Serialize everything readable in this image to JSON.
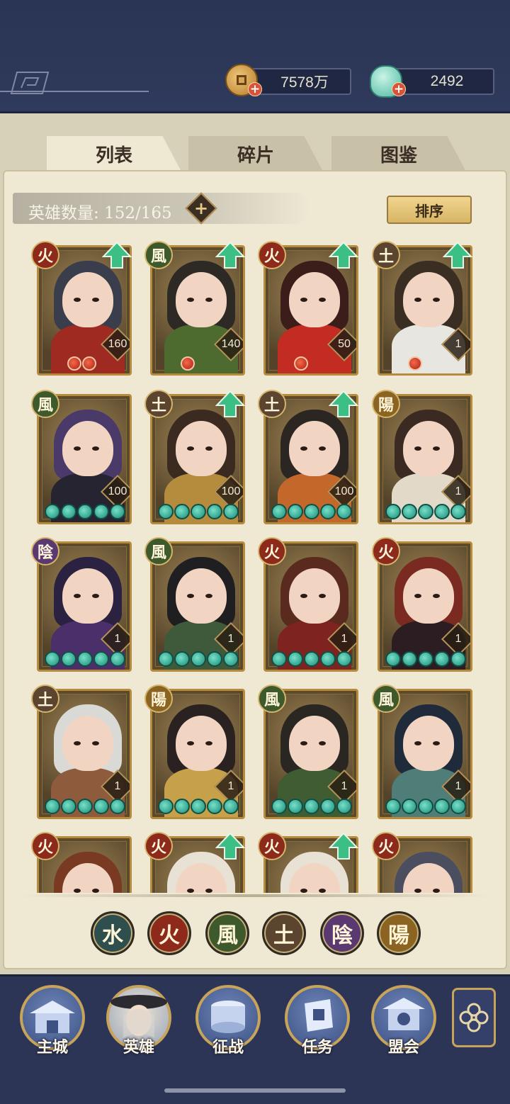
{
  "currency": {
    "coins": "7578万",
    "gems": "2492",
    "plus": "+"
  },
  "tabs": [
    "列表",
    "碎片",
    "图鉴"
  ],
  "hero_count": {
    "label": "英雄数量: 152/165",
    "plus": "+"
  },
  "sort_label": "排序",
  "heroes": [
    {
      "element": "火",
      "level": "160",
      "upgrade": true,
      "stars": 0,
      "badges": 2,
      "hair": "#3a3d4b",
      "outfit": "#9f2a22"
    },
    {
      "element": "風",
      "level": "140",
      "upgrade": true,
      "stars": 0,
      "badges": 1,
      "hair": "#2d2a25",
      "outfit": "#4d6b2f"
    },
    {
      "element": "火",
      "level": "50",
      "upgrade": true,
      "stars": 0,
      "badges": 1,
      "hair": "#3b1e1a",
      "outfit": "#c22c22"
    },
    {
      "element": "土",
      "level": "1",
      "upgrade": true,
      "stars": 0,
      "badges": 1,
      "hair": "#3a2e22",
      "outfit": "#e8e6e0"
    },
    {
      "element": "風",
      "level": "100",
      "upgrade": false,
      "stars": 5,
      "badges": 0,
      "hair": "#4a3a6a",
      "outfit": "#262430"
    },
    {
      "element": "土",
      "level": "100",
      "upgrade": true,
      "stars": 5,
      "badges": 0,
      "hair": "#3a2a20",
      "outfit": "#b58b3e"
    },
    {
      "element": "土",
      "level": "100",
      "upgrade": true,
      "stars": 5,
      "badges": 0,
      "hair": "#2c2622",
      "outfit": "#c4672a"
    },
    {
      "element": "陽",
      "level": "1",
      "upgrade": false,
      "stars": 5,
      "badges": 0,
      "hair": "#3a2a22",
      "outfit": "#e2d9c8"
    },
    {
      "element": "陰",
      "level": "1",
      "upgrade": false,
      "stars": 5,
      "badges": 0,
      "hair": "#2a2240",
      "outfit": "#4b2f6a"
    },
    {
      "element": "風",
      "level": "1",
      "upgrade": false,
      "stars": 5,
      "badges": 0,
      "hair": "#1f1f22",
      "outfit": "#3f5a3a"
    },
    {
      "element": "火",
      "level": "1",
      "upgrade": false,
      "stars": 5,
      "badges": 0,
      "hair": "#5a2a1e",
      "outfit": "#7e2320"
    },
    {
      "element": "火",
      "level": "1",
      "upgrade": false,
      "stars": 5,
      "badges": 0,
      "hair": "#7a2a20",
      "outfit": "#2b1d22"
    },
    {
      "element": "土",
      "level": "1",
      "upgrade": false,
      "stars": 5,
      "badges": 0,
      "hair": "#d9d9d6",
      "outfit": "#8e5b3d"
    },
    {
      "element": "陽",
      "level": "1",
      "upgrade": false,
      "stars": 5,
      "badges": 0,
      "hair": "#2a2220",
      "outfit": "#c7a14a"
    },
    {
      "element": "風",
      "level": "1",
      "upgrade": false,
      "stars": 5,
      "badges": 0,
      "hair": "#2a2622",
      "outfit": "#3f5c32"
    },
    {
      "element": "風",
      "level": "1",
      "upgrade": false,
      "stars": 5,
      "badges": 0,
      "hair": "#1f2a3a",
      "outfit": "#4f7d78"
    },
    {
      "element": "火",
      "level": "",
      "upgrade": false,
      "stars": 0,
      "badges": 0,
      "hair": "#7a3a22",
      "outfit": "#6a3522"
    },
    {
      "element": "火",
      "level": "",
      "upgrade": true,
      "stars": 0,
      "badges": 0,
      "hair": "#e8e2d4",
      "outfit": "#8c2a20"
    },
    {
      "element": "火",
      "level": "",
      "upgrade": true,
      "stars": 0,
      "badges": 0,
      "hair": "#e8e2d4",
      "outfit": "#8c2a20"
    },
    {
      "element": "火",
      "level": "",
      "upgrade": false,
      "stars": 0,
      "badges": 0,
      "hair": "#4a4e5e",
      "outfit": "#3a3d4b"
    }
  ],
  "filters": [
    {
      "label": "水",
      "class": "el-water"
    },
    {
      "label": "火",
      "class": "el-fire"
    },
    {
      "label": "風",
      "class": "el-wind"
    },
    {
      "label": "土",
      "class": "el-earth"
    },
    {
      "label": "陰",
      "class": "el-yin"
    },
    {
      "label": "陽",
      "class": "el-yang"
    }
  ],
  "nav": [
    "主城",
    "英雄",
    "征战",
    "任务",
    "盟会"
  ],
  "colors": {
    "header_bg": "#2a3454",
    "panel_bg": "#efe8d3",
    "gold_border": "#b68b3e",
    "star_teal": "#1a8b76",
    "upgrade_green": "#3cbf84"
  }
}
